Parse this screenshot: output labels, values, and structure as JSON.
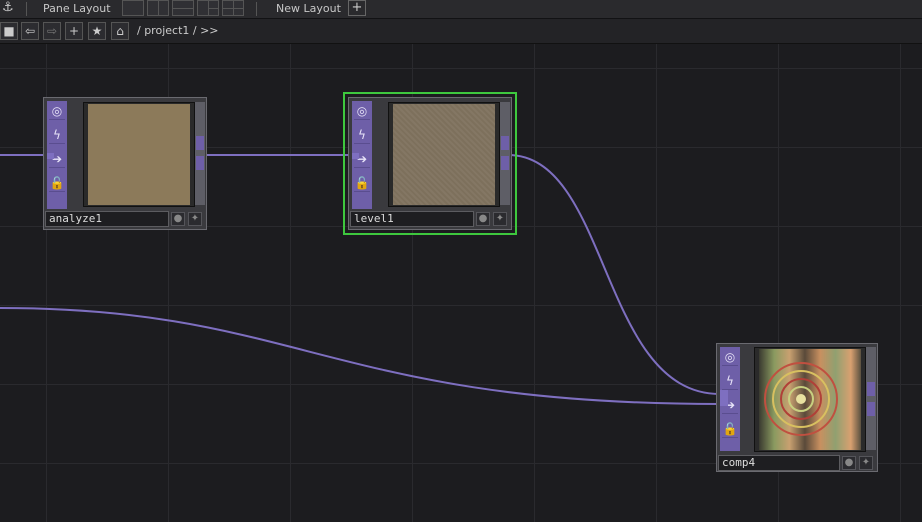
{
  "topbar": {
    "pane_layout_label": "Pane Layout",
    "new_layout_label": "New Layout",
    "add_symbol": "+"
  },
  "navbar": {
    "path": "/ project1 / >>"
  },
  "nodes": {
    "analyze1": {
      "name": "analyze1"
    },
    "level1": {
      "name": "level1"
    },
    "comp4": {
      "name": "comp4"
    }
  },
  "colors": {
    "wire": "#7e6fc0",
    "node_strip": "#6e5fa8",
    "selection": "#3ec83e",
    "canvas": "#1c1c1f"
  },
  "icons": [
    "viewer-active-icon",
    "bypass-icon",
    "display-flag-icon",
    "lock-icon"
  ]
}
